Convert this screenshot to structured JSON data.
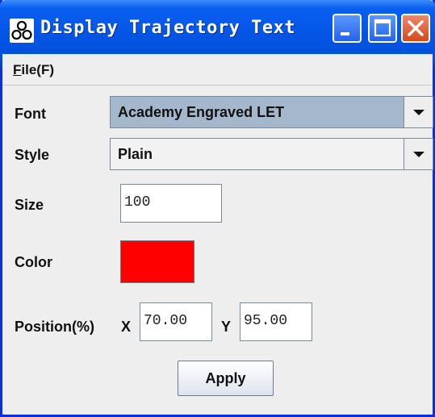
{
  "window": {
    "title": "Display Trajectory Text"
  },
  "menubar": {
    "file_mnemonic": "F",
    "file_rest": "ile(F)"
  },
  "form": {
    "font": {
      "label": "Font",
      "value": "Academy Engraved LET"
    },
    "style": {
      "label": "Style",
      "value": "Plain"
    },
    "size": {
      "label": "Size",
      "value": "100"
    },
    "color": {
      "label": "Color",
      "value": "#ff0000"
    },
    "position": {
      "label": "Position(%)",
      "x_label": "X",
      "x_value": "70.00",
      "y_label": "Y",
      "y_value": "95.00"
    },
    "apply_label": "Apply"
  },
  "icons": {
    "app": "trajectory-app-icon",
    "minimize": "minimize-icon",
    "maximize": "maximize-icon",
    "close": "close-icon",
    "dropdown": "chevron-down-icon"
  },
  "colors": {
    "titlebar": "#0455e6",
    "combo_selected_bg": "#a4b7cc",
    "swatch": "#ff0000"
  }
}
